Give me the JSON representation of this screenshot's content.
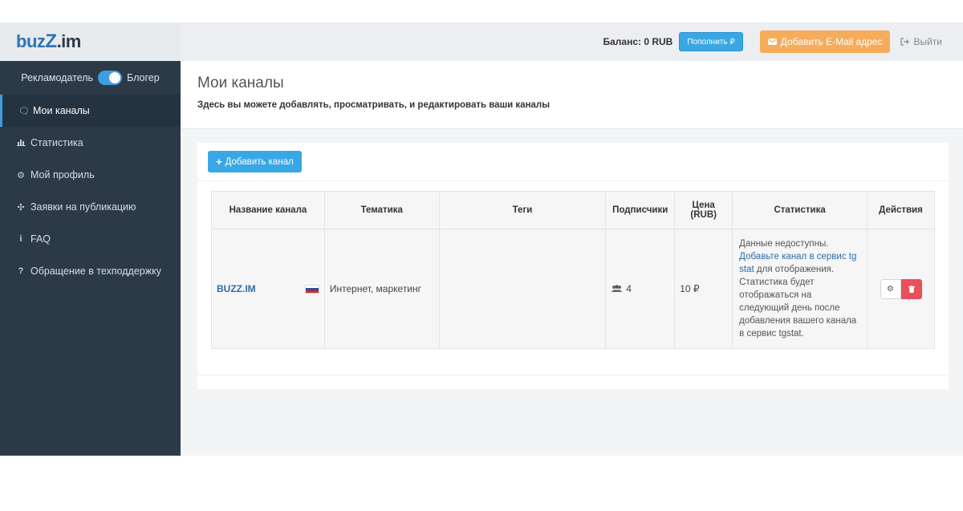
{
  "brand": {
    "logo_text_a": "buz",
    "logo_text_z": "Z",
    "logo_text_b": ".im"
  },
  "sidebar": {
    "role_left": "Рекламодатель",
    "role_right": "Блогер",
    "items": [
      {
        "icon": "chat-icon",
        "glyph": "🗨",
        "label": "Мои каналы"
      },
      {
        "icon": "bar-chart-icon",
        "glyph": "📊",
        "label": "Статистика"
      },
      {
        "icon": "gear-icon",
        "glyph": "⚙",
        "label": "Мой профиль"
      },
      {
        "icon": "move-icon",
        "glyph": "✣",
        "label": "Заявки на публикацию"
      },
      {
        "icon": "info-icon",
        "glyph": "i",
        "label": "FAQ"
      },
      {
        "icon": "question-icon",
        "glyph": "?",
        "label": "Обращение в техподдержку"
      }
    ]
  },
  "header": {
    "balance": "Баланс: 0 RUB",
    "topup_label": "Пополнить ₽",
    "email_label": "Добавить E-Mail адрес",
    "logout_label": "Выйти"
  },
  "page": {
    "title": "Мои каналы",
    "subtitle": "Здесь вы можете добавлять, просматривать, и редактировать ваши каналы",
    "add_label": "Добавить канал"
  },
  "table": {
    "headers": [
      "Название канала",
      "Тематика",
      "Теги",
      "Подписчики",
      "Цена (RUB)",
      "Статистика",
      "Действия"
    ],
    "row": {
      "name": "BUZZ.IM",
      "topic": "Интернет, маркетинг",
      "tags": "",
      "subscribers": "4",
      "price": "10 ₽",
      "stats_line1": "Данные недоступны.",
      "stats_link": "Добавьте канал в сервис tg stat",
      "stats_rest": "для отображения. Статистика будет отображаться на следующий день после добавления вашего канала в сервис tgstat."
    }
  }
}
